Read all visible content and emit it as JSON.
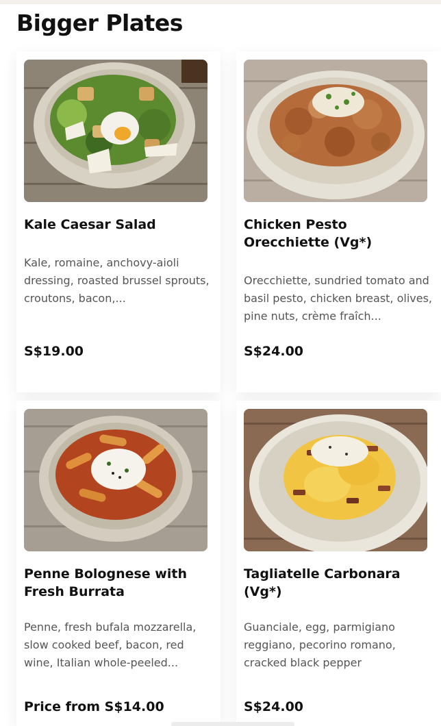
{
  "section": {
    "title": "Bigger Plates"
  },
  "items": [
    {
      "name": "Kale Caesar Salad",
      "description": "Kale, romaine, anchovy-aioli dressing, roasted brussel sprouts, croutons, bacon,...",
      "price": "S$19.00",
      "image_icon": "salad-dish-image"
    },
    {
      "name": "Chicken Pesto Orecchiette (Vg*)",
      "description": "Orecchiette, sundried tomato and basil pesto, chicken breast, olives, pine nuts, crème fraîch...",
      "price": "S$24.00",
      "image_icon": "pasta-dish-image"
    },
    {
      "name": "Penne Bolognese with Fresh Burrata",
      "description": "Penne, fresh bufala mozzarella, slow cooked beef, bacon, red wine, Italian whole-peeled...",
      "price": "Price from S$14.00",
      "image_icon": "penne-dish-image"
    },
    {
      "name": "Tagliatelle Carbonara (Vg*)",
      "description": "Guanciale, egg, parmigiano reggiano, pecorino romano, cracked black pepper",
      "price": "S$24.00",
      "image_icon": "carbonara-dish-image"
    }
  ],
  "colors": {
    "background": "#ffffff",
    "text": "#111111",
    "muted_text": "#555555"
  }
}
